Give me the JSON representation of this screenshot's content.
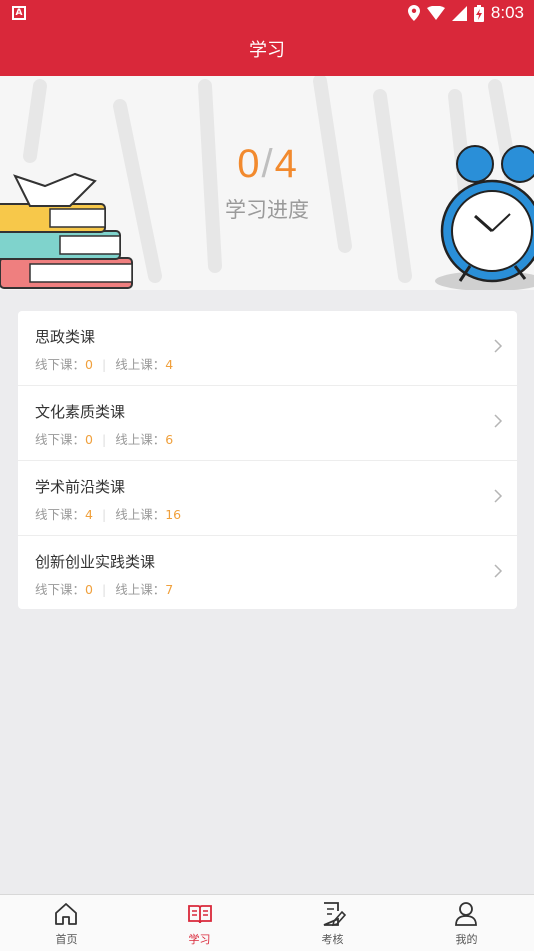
{
  "status": {
    "time": "8:03",
    "left_icon": "notification-a-icon"
  },
  "appbar": {
    "title": "学习"
  },
  "progress": {
    "done": "0",
    "separator": "/",
    "total": "4",
    "label": "学习进度"
  },
  "courses": [
    {
      "title": "思政类课",
      "offline_label": "线下课：",
      "offline": "0",
      "online_label": "线上课：",
      "online": "4"
    },
    {
      "title": "文化素质类课",
      "offline_label": "线下课：",
      "offline": "0",
      "online_label": "线上课：",
      "online": "6"
    },
    {
      "title": "学术前沿类课",
      "offline_label": "线下课：",
      "offline": "4",
      "online_label": "线上课：",
      "online": "16"
    },
    {
      "title": "创新创业实践类课",
      "offline_label": "线下课：",
      "offline": "0",
      "online_label": "线上课：",
      "online": "7"
    }
  ],
  "tabs": [
    {
      "label": "首页",
      "icon": "home-icon"
    },
    {
      "label": "学习",
      "icon": "book-icon",
      "active": true
    },
    {
      "label": "考核",
      "icon": "edit-doc-icon"
    },
    {
      "label": "我的",
      "icon": "user-icon"
    }
  ],
  "colors": {
    "accent": "#d9283a",
    "orange": "#f28a2e",
    "number": "#f0a03c"
  }
}
